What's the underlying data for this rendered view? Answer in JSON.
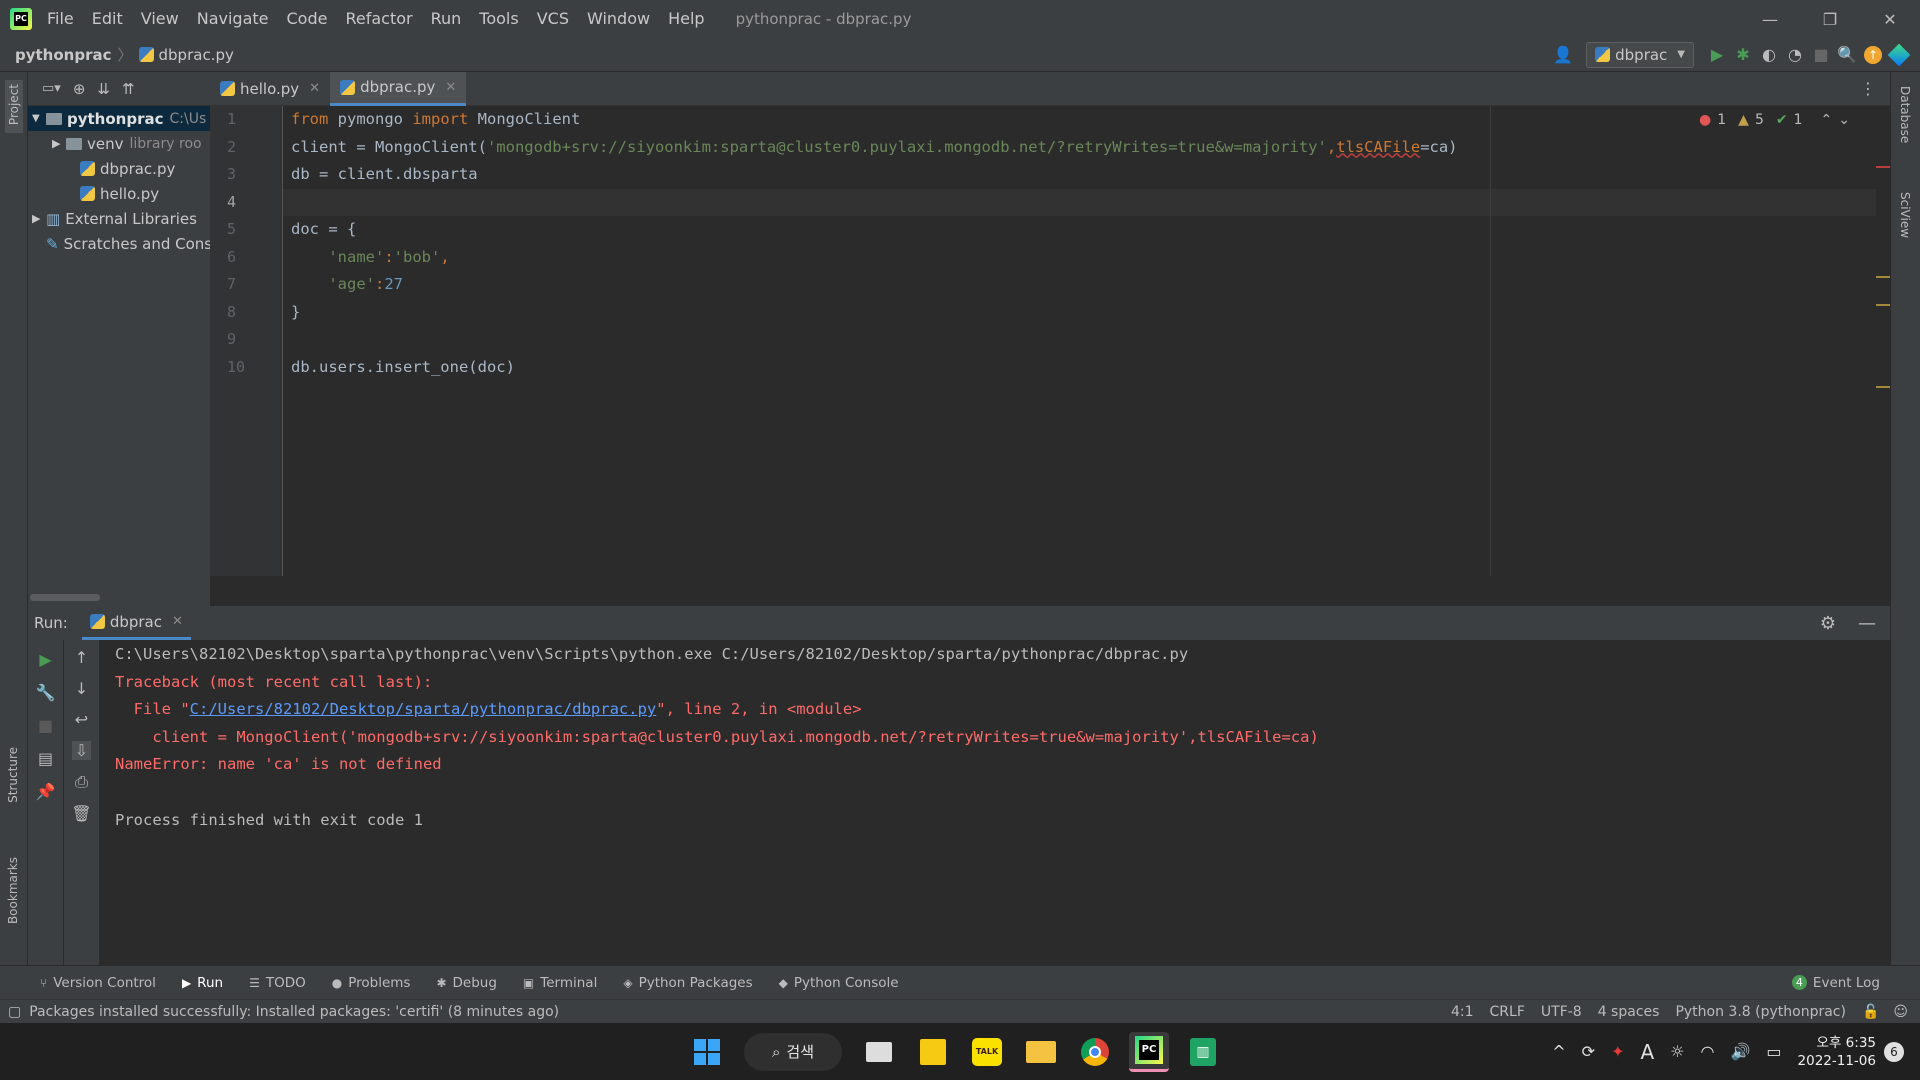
{
  "window": {
    "title": "pythonprac - dbprac.py",
    "menu": [
      "File",
      "Edit",
      "View",
      "Navigate",
      "Code",
      "Refactor",
      "Run",
      "Tools",
      "VCS",
      "Window",
      "Help"
    ]
  },
  "navbar": {
    "project": "pythonprac",
    "file": "dbprac.py",
    "run_config": "dbprac"
  },
  "sidebar": {
    "left_labels": [
      "Project",
      "Structure",
      "Bookmarks"
    ],
    "right_labels": [
      "Database",
      "SciView"
    ]
  },
  "project_tree": [
    {
      "label": "pythonprac",
      "hint": "C:\\Us",
      "type": "root-folder",
      "expanded": true
    },
    {
      "label": "venv",
      "hint": "library roo",
      "type": "folder",
      "expanded": false
    },
    {
      "label": "dbprac.py",
      "hint": "",
      "type": "py"
    },
    {
      "label": "hello.py",
      "hint": "",
      "type": "py"
    },
    {
      "label": "External Libraries",
      "hint": "",
      "type": "libraries",
      "expanded": false
    },
    {
      "label": "Scratches and Cons",
      "hint": "",
      "type": "scratches"
    }
  ],
  "tabs": [
    {
      "label": "hello.py",
      "active": false
    },
    {
      "label": "dbprac.py",
      "active": true
    }
  ],
  "inspections": {
    "errors": "1",
    "warnings": "5",
    "typos": "1"
  },
  "editor": {
    "line_numbers": [
      "1",
      "2",
      "3",
      "4",
      "5",
      "6",
      "7",
      "8",
      "9",
      "10"
    ],
    "lines": {
      "l1_kw1": "from",
      "l1_mod": " pymongo ",
      "l1_kw2": "import",
      "l1_rest": " MongoClient",
      "l2_a": "client = MongoClient(",
      "l2_str": "'mongodb+srv://siyoonkim:sparta@cluster0.puylaxi.mongodb.net/?retryWrites=true&w=majority'",
      "l2_comma": ",",
      "l2_kw": "tlsCAFile",
      "l2_b": "=ca)",
      "l3": "db = client.dbsparta",
      "l4": "",
      "l5": "doc = {",
      "l6_str1": "'name'",
      "l6_colon": ":",
      "l6_str2": "'bob'",
      "l6_end": ",",
      "l7_str": "'age'",
      "l7_colon": ":",
      "l7_num": "27",
      "l8": "}",
      "l9": "",
      "l10": "db.users.insert_one(doc)"
    }
  },
  "run_panel": {
    "label": "Run:",
    "tab": "dbprac",
    "output": {
      "cmd": "C:\\Users\\82102\\Desktop\\sparta\\pythonprac\\venv\\Scripts\\python.exe C:/Users/82102/Desktop/sparta/pythonprac/dbprac.py",
      "traceback": "Traceback (most recent call last):",
      "file_prefix": "  File \"",
      "file_link": "C:/Users/82102/Desktop/sparta/pythonprac/dbprac.py",
      "file_suffix": "\", line 2, in <module>",
      "code_line": "    client = MongoClient('mongodb+srv://siyoonkim:sparta@cluster0.puylaxi.mongodb.net/?retryWrites=true&w=majority',tlsCAFile=ca)",
      "error": "NameError: name 'ca' is not defined",
      "blank": "",
      "exit": "Process finished with exit code 1"
    }
  },
  "tool_windows": [
    "Version Control",
    "Run",
    "TODO",
    "Problems",
    "Debug",
    "Terminal",
    "Python Packages",
    "Python Console"
  ],
  "event_log": {
    "count": "4",
    "label": "Event Log"
  },
  "status": {
    "message": "Packages installed successfully: Installed packages: 'certifi' (8 minutes ago)",
    "position": "4:1",
    "line_sep": "CRLF",
    "encoding": "UTF-8",
    "indent": "4 spaces",
    "interpreter": "Python 3.8 (pythonprac)"
  },
  "taskbar": {
    "search_label": "검색",
    "time": "오후 6:35",
    "date": "2022-11-06",
    "notifications": "6",
    "tray_lang": "A"
  },
  "colors": {
    "accent": "#4a88c7",
    "error_red": "#ff6b68",
    "run_green": "#499c54"
  }
}
